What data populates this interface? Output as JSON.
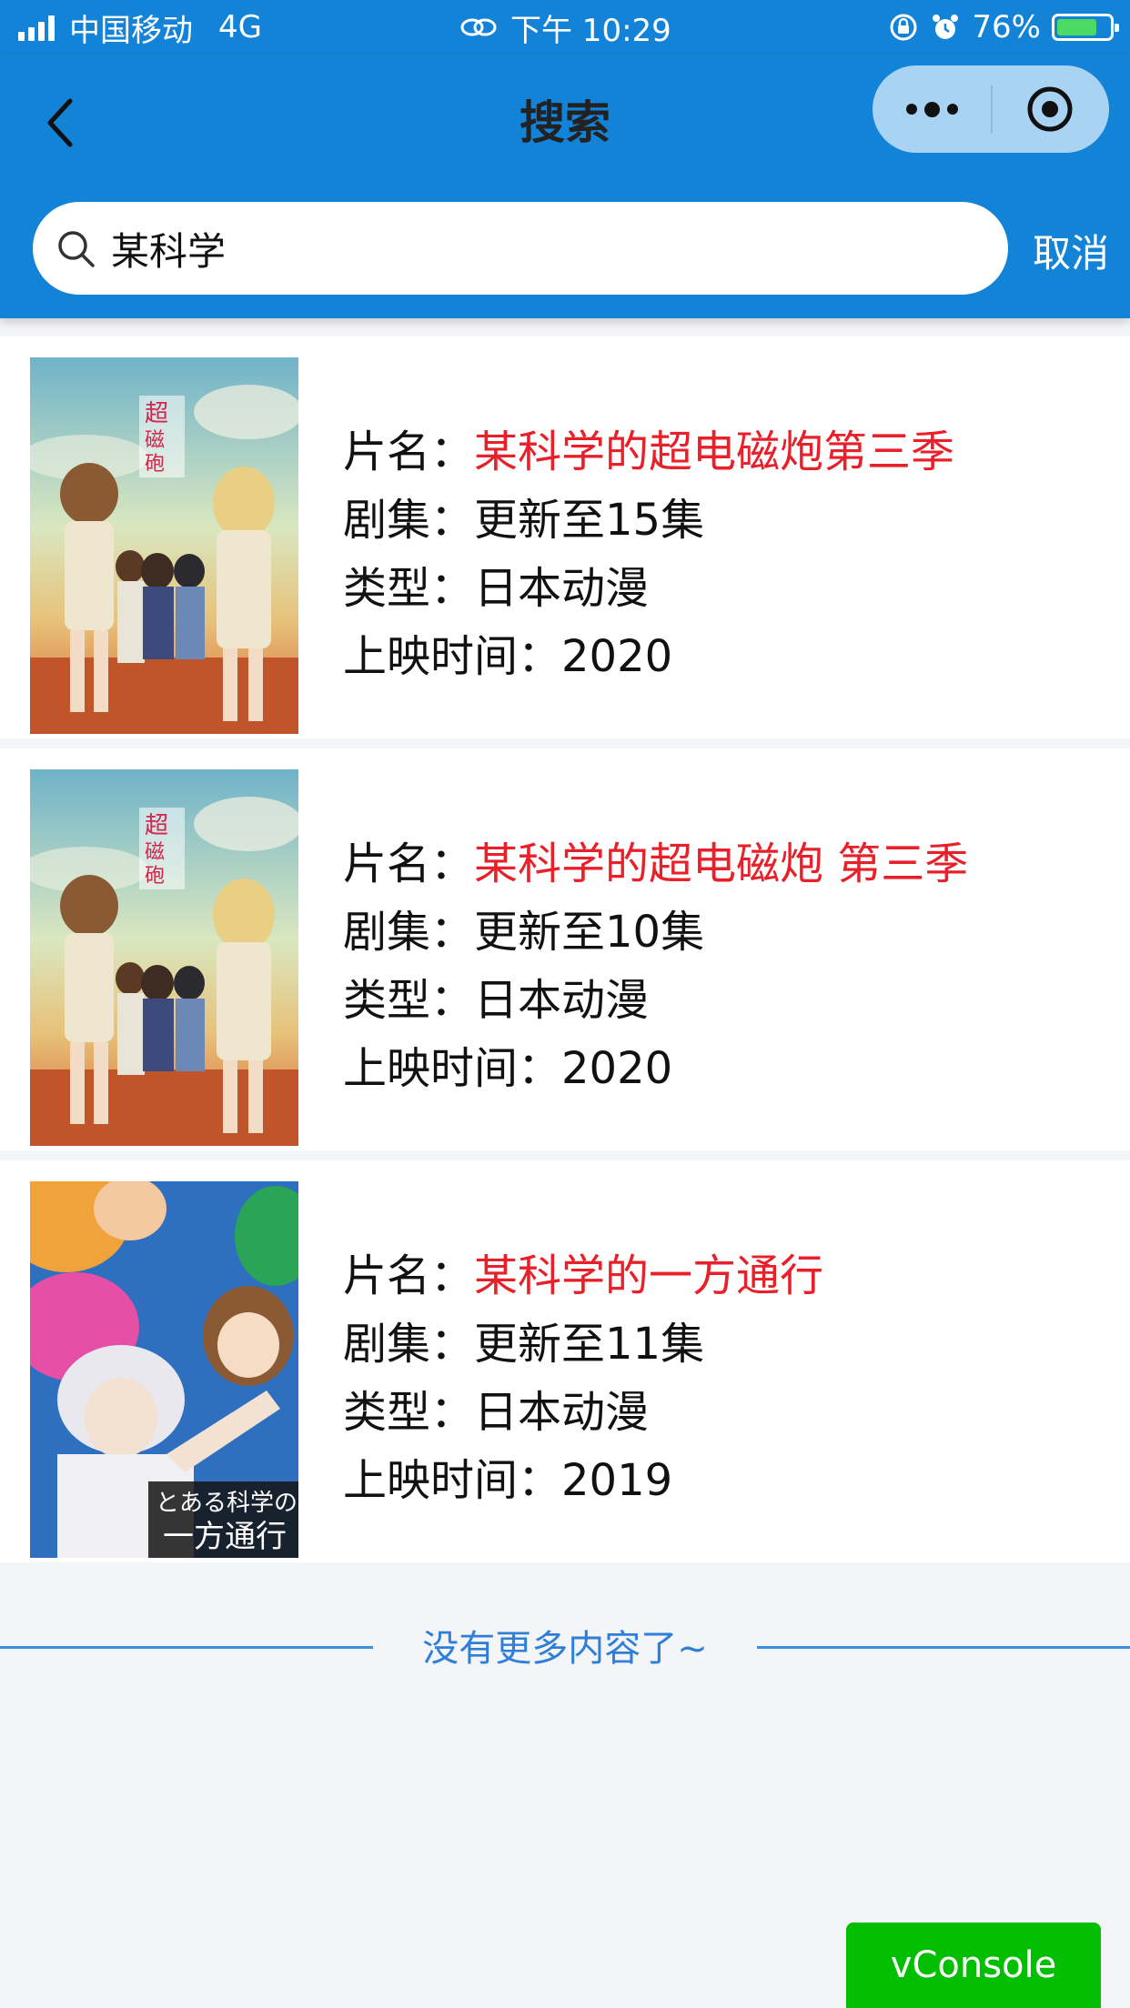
{
  "status_bar": {
    "carrier": "中国移动",
    "network": "4G",
    "time": "下午 10:29",
    "battery_percent": "76%",
    "battery_level": 0.76
  },
  "nav": {
    "title": "搜索",
    "back_icon": "chevron-left-icon",
    "more_icon": "more-dots-icon",
    "close_icon": "target-icon"
  },
  "search": {
    "value": "某科学",
    "placeholder": "",
    "cancel_label": "取消",
    "icon": "search-icon"
  },
  "labels": {
    "title": "片名：",
    "episodes": "剧集：",
    "genre": "类型：",
    "release": "上映时间："
  },
  "results": [
    {
      "title": "某科学的超电磁炮第三季",
      "episodes": "更新至15集",
      "genre": "日本动漫",
      "year": "2020"
    },
    {
      "title": "某科学的超电磁炮 第三季",
      "episodes": "更新至10集",
      "genre": "日本动漫",
      "year": "2020"
    },
    {
      "title": "某科学的一方通行",
      "episodes": "更新至11集",
      "genre": "日本动漫",
      "year": "2019"
    }
  ],
  "footer": {
    "end_text": "没有更多内容了~",
    "vconsole_label": "vConsole"
  },
  "colors": {
    "nav_bg": "#1383d8",
    "title_red": "#e8202a",
    "vconsole_green": "#04be02",
    "end_blue": "#2f7ed8"
  }
}
